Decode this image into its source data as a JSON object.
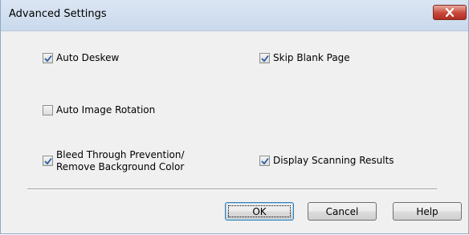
{
  "window": {
    "title": "Advanced Settings"
  },
  "options": [
    {
      "id": "auto-deskew",
      "label": "Auto Deskew",
      "checked": true
    },
    {
      "id": "skip-blank-page",
      "label": "Skip Blank Page",
      "checked": true
    },
    {
      "id": "auto-image-rotation",
      "label": "Auto Image Rotation",
      "checked": false
    },
    {
      "id": "bleed-through",
      "label": "Bleed Through Prevention/\nRemove Background Color",
      "checked": true
    },
    {
      "id": "display-scanning-results",
      "label": "Display Scanning Results",
      "checked": true
    }
  ],
  "buttons": {
    "ok": "OK",
    "cancel": "Cancel",
    "help": "Help"
  },
  "icons": {
    "close": "close-icon",
    "check": "checkmark-icon"
  },
  "colors": {
    "titlebar": "#c9d9ec",
    "close_button": "#c7473a",
    "checkmark": "#2c5ea0"
  }
}
